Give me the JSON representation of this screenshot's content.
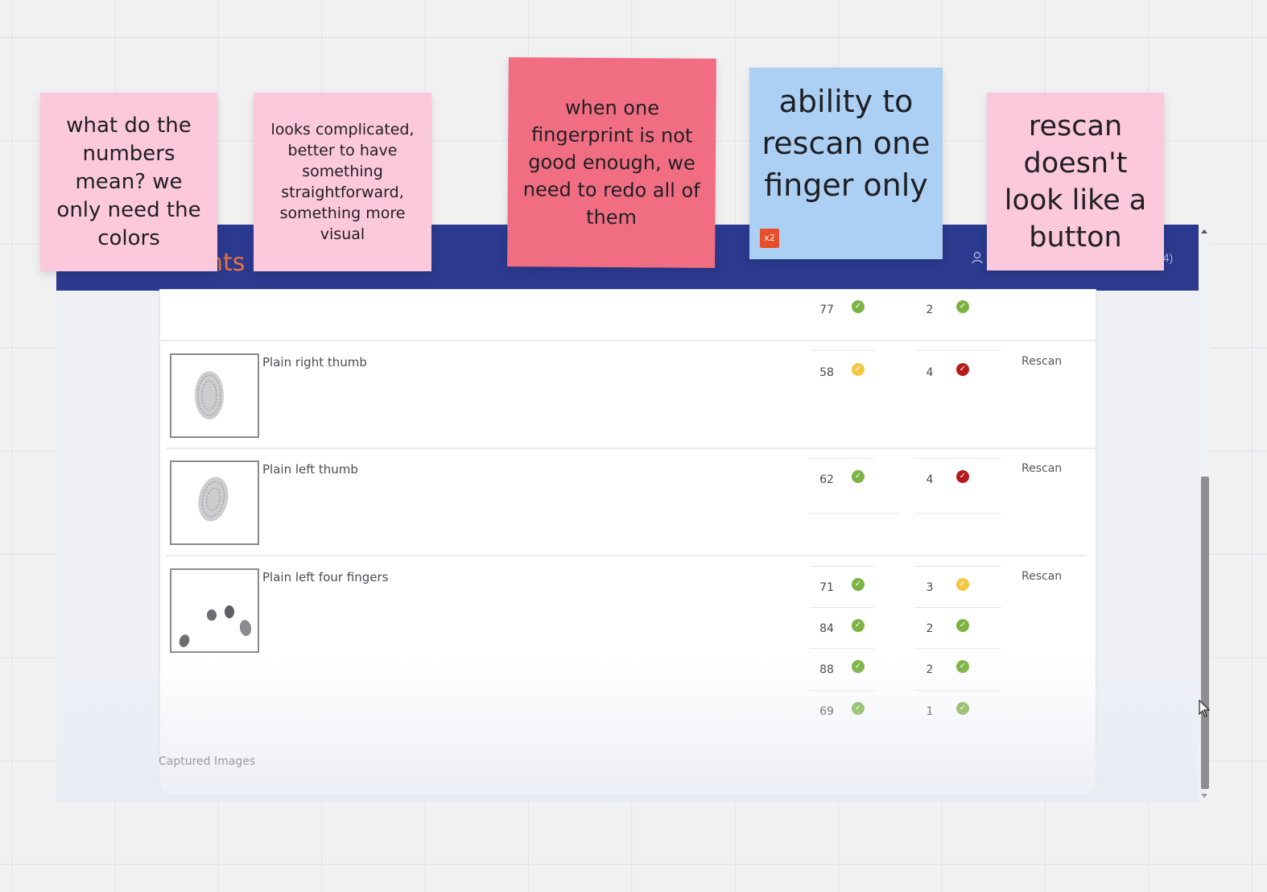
{
  "app": {
    "title_fragment": "nts",
    "header_suffix": "94)"
  },
  "table": {
    "rows": [
      {
        "label": "",
        "scores": [
          {
            "quality": "77",
            "quality_status": "green",
            "rank": "2",
            "rank_status": "green"
          }
        ],
        "action": ""
      },
      {
        "label": "Plain right thumb",
        "scores": [
          {
            "quality": "58",
            "quality_status": "yellow",
            "rank": "4",
            "rank_status": "red"
          }
        ],
        "action": "Rescan"
      },
      {
        "label": "Plain left thumb",
        "scores": [
          {
            "quality": "62",
            "quality_status": "green",
            "rank": "4",
            "rank_status": "red"
          }
        ],
        "action": "Rescan"
      },
      {
        "label": "Plain left four fingers",
        "scores": [
          {
            "quality": "71",
            "quality_status": "green",
            "rank": "3",
            "rank_status": "yellow"
          },
          {
            "quality": "84",
            "quality_status": "green",
            "rank": "2",
            "rank_status": "green"
          },
          {
            "quality": "88",
            "quality_status": "green",
            "rank": "2",
            "rank_status": "green"
          },
          {
            "quality": "69",
            "quality_status": "green",
            "rank": "1",
            "rank_status": "green"
          }
        ],
        "action": "Rescan"
      }
    ],
    "section_footer": "Captured Images"
  },
  "status_colors": {
    "green": "#7cb342",
    "yellow": "#f2c744",
    "red": "#b71c1c"
  },
  "notes": [
    {
      "text": "what do the numbers mean? we only need the colors",
      "color": "#fcc8dc"
    },
    {
      "text": "looks complicated, better to have something straightforward, something more visual",
      "color": "#fcc8dc"
    },
    {
      "text": "when one fingerprint is not good enough, we need to redo all of them",
      "color": "#f16e82"
    },
    {
      "text": "ability to rescan one finger only",
      "color": "#acd0f4",
      "badge": "x2"
    },
    {
      "text": "rescan doesn't look like a button",
      "color": "#fcc8dc"
    }
  ],
  "icons": {
    "status": "check-circle-icon",
    "header_user": "user-icon",
    "cursor": "mouse-pointer-icon"
  },
  "colors": {
    "header_bg": "#2b3a8f",
    "title_accent": "#e8733a",
    "vote_badge": "#e94e2a"
  }
}
